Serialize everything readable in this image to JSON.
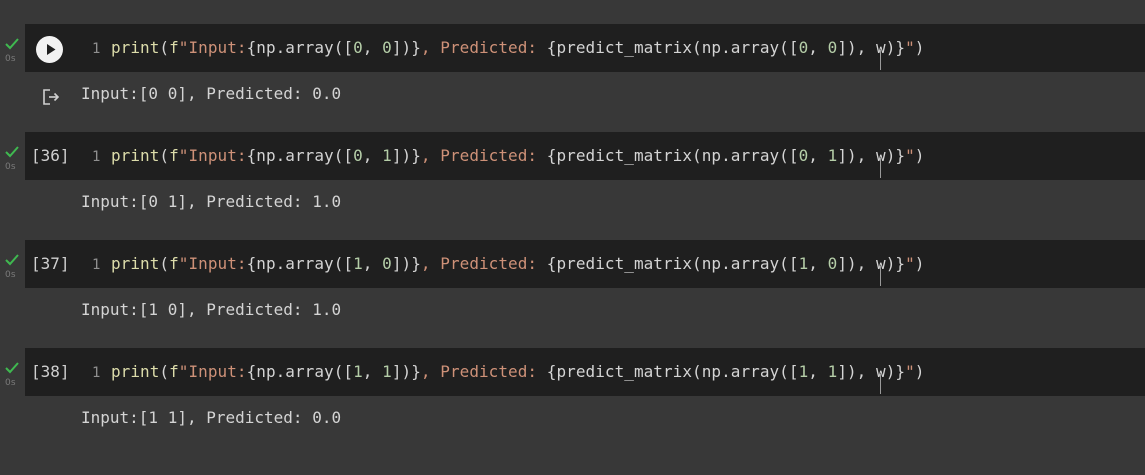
{
  "cells": [
    {
      "status": "completed",
      "exec_time": "0s",
      "exec_count": "",
      "show_run_button": true,
      "line_number": "1",
      "code": {
        "fn": "print",
        "open": "(",
        "prefix": "f",
        "str1": "\"Input:",
        "expr1_pre": "{np.array([",
        "n1": "0",
        "sep1": ", ",
        "n2": "0",
        "expr1_post": "])}",
        "str2": ", Predicted: ",
        "expr2_pre": "{predict_matrix(np.array([",
        "n3": "0",
        "sep2": ", ",
        "n4": "0",
        "expr2_post": "]), w)}",
        "str3": "\"",
        "close": ")"
      },
      "output": "Input:[0 0], Predicted: 0.0"
    },
    {
      "status": "completed",
      "exec_time": "0s",
      "exec_count": "[36]",
      "show_run_button": false,
      "line_number": "1",
      "code": {
        "fn": "print",
        "open": "(",
        "prefix": "f",
        "str1": "\"Input:",
        "expr1_pre": "{np.array([",
        "n1": "0",
        "sep1": ", ",
        "n2": "1",
        "expr1_post": "])}",
        "str2": ", Predicted: ",
        "expr2_pre": "{predict_matrix(np.array([",
        "n3": "0",
        "sep2": ", ",
        "n4": "1",
        "expr2_post": "]), w)}",
        "str3": "\"",
        "close": ")"
      },
      "output": "Input:[0 1], Predicted: 1.0"
    },
    {
      "status": "completed",
      "exec_time": "0s",
      "exec_count": "[37]",
      "show_run_button": false,
      "line_number": "1",
      "code": {
        "fn": "print",
        "open": "(",
        "prefix": "f",
        "str1": "\"Input:",
        "expr1_pre": "{np.array([",
        "n1": "1",
        "sep1": ", ",
        "n2": "0",
        "expr1_post": "])}",
        "str2": ", Predicted: ",
        "expr2_pre": "{predict_matrix(np.array([",
        "n3": "1",
        "sep2": ", ",
        "n4": "0",
        "expr2_post": "]), w)}",
        "str3": "\"",
        "close": ")"
      },
      "output": "Input:[1 0], Predicted: 1.0"
    },
    {
      "status": "completed",
      "exec_time": "0s",
      "exec_count": "[38]",
      "show_run_button": false,
      "line_number": "1",
      "code": {
        "fn": "print",
        "open": "(",
        "prefix": "f",
        "str1": "\"Input:",
        "expr1_pre": "{np.array([",
        "n1": "1",
        "sep1": ", ",
        "n2": "1",
        "expr1_post": "])}",
        "str2": ", Predicted: ",
        "expr2_pre": "{predict_matrix(np.array([",
        "n3": "1",
        "sep2": ", ",
        "n4": "1",
        "expr2_post": "]), w)}",
        "str3": "\"",
        "close": ")"
      },
      "output": "Input:[1 1], Predicted: 0.0"
    }
  ],
  "icons": {
    "status": "check-icon",
    "run": "play-icon",
    "output": "output-redirect-icon"
  },
  "colors": {
    "page_background": "#383838",
    "code_background": "#1f1f1f",
    "check": "#3fb950",
    "function": "#dcdcaa",
    "string": "#ce9178",
    "number": "#b5cea8",
    "text": "#d4d4d4"
  }
}
